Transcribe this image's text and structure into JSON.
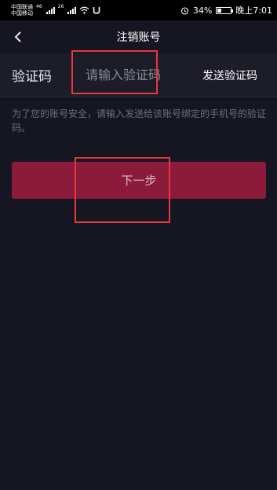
{
  "status_bar": {
    "carrier_1": "中国联通",
    "carrier_2": "中国移动",
    "net_1": "46",
    "net_2": "26",
    "battery": "34%",
    "time": "晚上7:01"
  },
  "header": {
    "title": "注销账号",
    "back_icon": "chevron-left-icon"
  },
  "code_row": {
    "label": "验证码",
    "placeholder": "请输入验证码",
    "value": "",
    "send_label": "发送验证码"
  },
  "description": "为了您的账号安全，请输入发送给该账号绑定的手机号的验证码。",
  "next_button": {
    "label": "下一步"
  },
  "colors": {
    "background": "#161622",
    "input_row": "#1d1d2a",
    "button": "#8c1a3b",
    "highlight": "#e8393a",
    "hint_text": "#6e6e7a"
  },
  "battery_level": 0.34
}
